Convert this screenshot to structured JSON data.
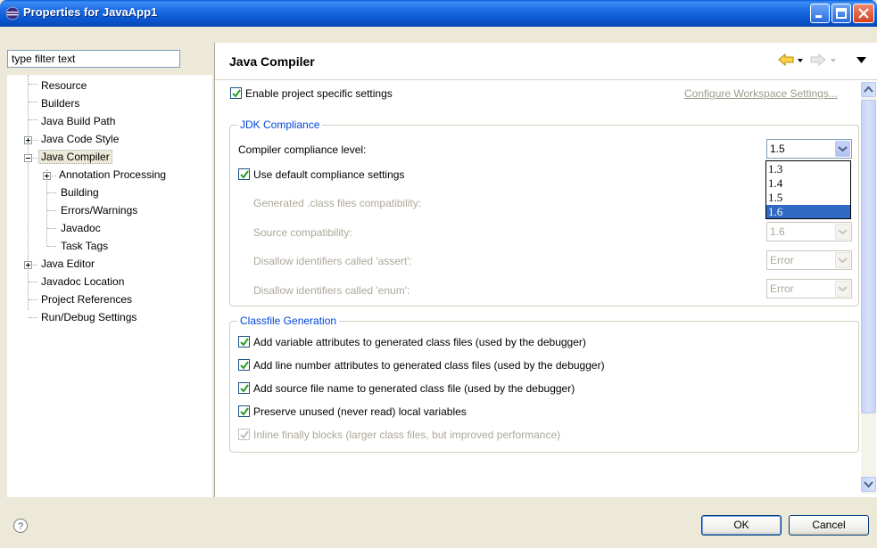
{
  "window": {
    "title": "Properties for JavaApp1"
  },
  "filter": {
    "placeholder": "type filter text",
    "value": "type filter text"
  },
  "tree": {
    "items": [
      {
        "label": "Resource"
      },
      {
        "label": "Builders"
      },
      {
        "label": "Java Build Path"
      },
      {
        "label": "Java Code Style"
      },
      {
        "label": "Java Compiler"
      },
      {
        "label": "Annotation Processing"
      },
      {
        "label": "Building"
      },
      {
        "label": "Errors/Warnings"
      },
      {
        "label": "Javadoc"
      },
      {
        "label": "Task Tags"
      },
      {
        "label": "Java Editor"
      },
      {
        "label": "Javadoc Location"
      },
      {
        "label": "Project References"
      },
      {
        "label": "Run/Debug Settings"
      }
    ]
  },
  "page": {
    "title": "Java Compiler",
    "enable_project_settings": "Enable project specific settings",
    "configure_workspace": "Configure Workspace Settings..."
  },
  "jdk": {
    "group_title": "JDK Compliance",
    "compliance_label": "Compiler compliance level:",
    "compliance_value": "1.5",
    "use_default": "Use default compliance settings",
    "generated_label": "Generated .class files compatibility:",
    "source_label": "Source compatibility:",
    "source_value": "1.6",
    "assert_label": "Disallow identifiers called 'assert':",
    "assert_value": "Error",
    "enum_label": "Disallow identifiers called 'enum':",
    "enum_value": "Error",
    "dropdown_options": [
      "1.3",
      "1.4",
      "1.5",
      "1.6"
    ],
    "dropdown_selected": "1.6"
  },
  "classfile": {
    "group_title": "Classfile Generation",
    "opt1": "Add variable attributes to generated class files (used by the debugger)",
    "opt2": "Add line number attributes to generated class files (used by the debugger)",
    "opt3": "Add source file name to generated class file (used by the debugger)",
    "opt4": "Preserve unused (never read) local variables",
    "opt5": "Inline finally blocks (larger class files, but improved performance)"
  },
  "buttons": {
    "ok": "OK",
    "cancel": "Cancel"
  },
  "colors": {
    "titlebar": "#0a58d0",
    "selection": "#316ac5",
    "group_title": "#0046d5"
  }
}
